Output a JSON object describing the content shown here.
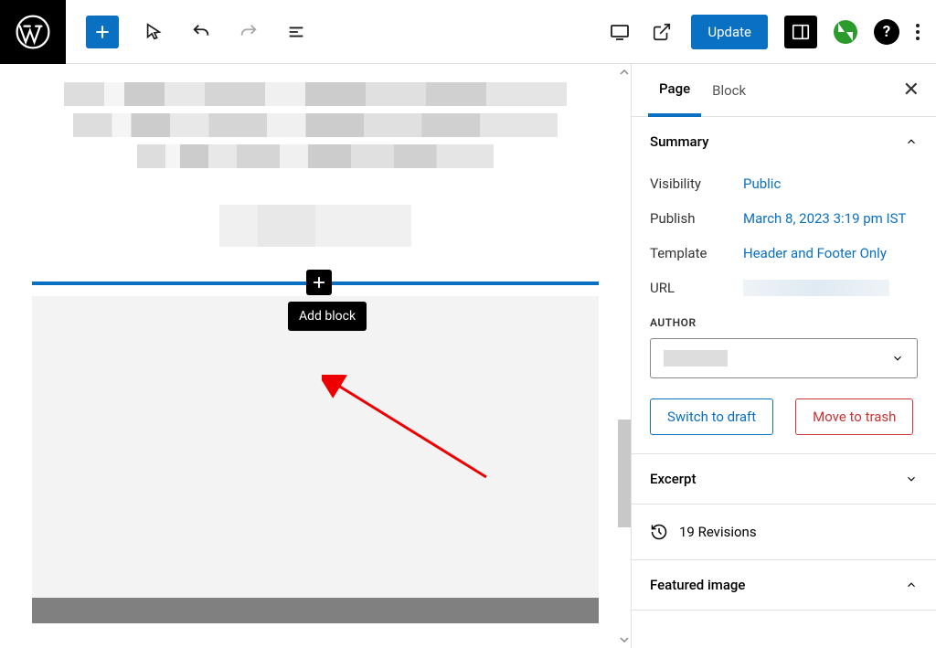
{
  "toolbar": {
    "update_label": "Update"
  },
  "editor": {
    "tooltip": "Add block"
  },
  "sidebar": {
    "tabs": {
      "page": "Page",
      "block": "Block"
    },
    "summary": {
      "title": "Summary",
      "visibility_label": "Visibility",
      "visibility_value": "Public",
      "publish_label": "Publish",
      "publish_value": "March 8, 2023 3:19 pm IST",
      "template_label": "Template",
      "template_value": "Header and Footer Only",
      "url_label": "URL",
      "author_label": "AUTHOR",
      "switch_draft": "Switch to draft",
      "move_trash": "Move to trash"
    },
    "excerpt_label": "Excerpt",
    "revisions_label": "19 Revisions",
    "featured_image_label": "Featured image"
  }
}
